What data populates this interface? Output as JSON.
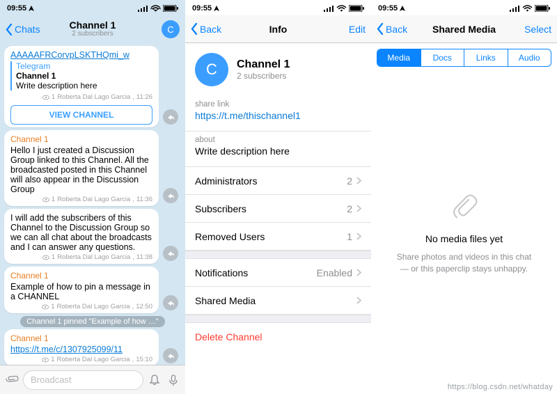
{
  "statusbar": {
    "time": "09:55"
  },
  "screen1": {
    "nav": {
      "back": "Chats",
      "title": "Channel 1",
      "subtitle": "2 subscribers",
      "avatar_letter": "C"
    },
    "messages": [
      {
        "link_text": "AAAAAFRCorvpLSKTHQmi_w",
        "quote": {
          "site": "Telegram",
          "name": "Channel 1",
          "desc": "Write description here"
        },
        "button": "VIEW CHANNEL",
        "views": "1",
        "author": "Roberta Dal Lago Garcia",
        "time": "11:26"
      },
      {
        "sender": "Channel 1",
        "text": "Hello I just created a Discussion Group linked to this Channel. All the broadcasted posted in this Channel will also appear in the Discussion Group",
        "views": "1",
        "author": "Roberta Dal Lago Garcia",
        "time": "11:36"
      },
      {
        "text": "I will add the subscribers of this Channel to the Discussion Group so we can all chat about the broadcasts and I can answer any questions.",
        "views": "1",
        "author": "Roberta Dal Lago Garcia",
        "time": "11:38"
      },
      {
        "sender": "Channel 1",
        "text": "Example of how to pin a message in a CHANNEL",
        "views": "1",
        "author": "Roberta Dal Lago Garcia",
        "time": "12:50"
      },
      {
        "sender": "Channel 1",
        "link_text": "https://t.me/c/1307925099/11",
        "views": "1",
        "author": "Roberta Dal Lago Garcia",
        "time": "15:10"
      }
    ],
    "pinned_text": "Channel 1 pinned \"Example of how …\"",
    "compose_placeholder": "Broadcast"
  },
  "screen2": {
    "nav": {
      "back": "Back",
      "title": "Info",
      "action": "Edit"
    },
    "profile": {
      "letter": "C",
      "name": "Channel 1",
      "sub": "2 subscribers"
    },
    "share": {
      "label": "share link",
      "value": "https://t.me/thischannel1"
    },
    "about": {
      "label": "about",
      "value": "Write description here"
    },
    "rows": {
      "admins": {
        "label": "Administrators",
        "value": "2"
      },
      "subs": {
        "label": "Subscribers",
        "value": "2"
      },
      "removed": {
        "label": "Removed Users",
        "value": "1"
      },
      "notif": {
        "label": "Notifications",
        "value": "Enabled"
      },
      "shared": {
        "label": "Shared Media"
      },
      "delete": {
        "label": "Delete Channel"
      }
    }
  },
  "screen3": {
    "nav": {
      "back": "Back",
      "title": "Shared Media",
      "action": "Select"
    },
    "tabs": [
      "Media",
      "Docs",
      "Links",
      "Audio"
    ],
    "empty": {
      "title": "No media files yet",
      "subtitle": "Share photos and videos in this chat — or this paperclip stays unhappy."
    }
  },
  "watermark": "https://blog.csdn.net/whatday"
}
